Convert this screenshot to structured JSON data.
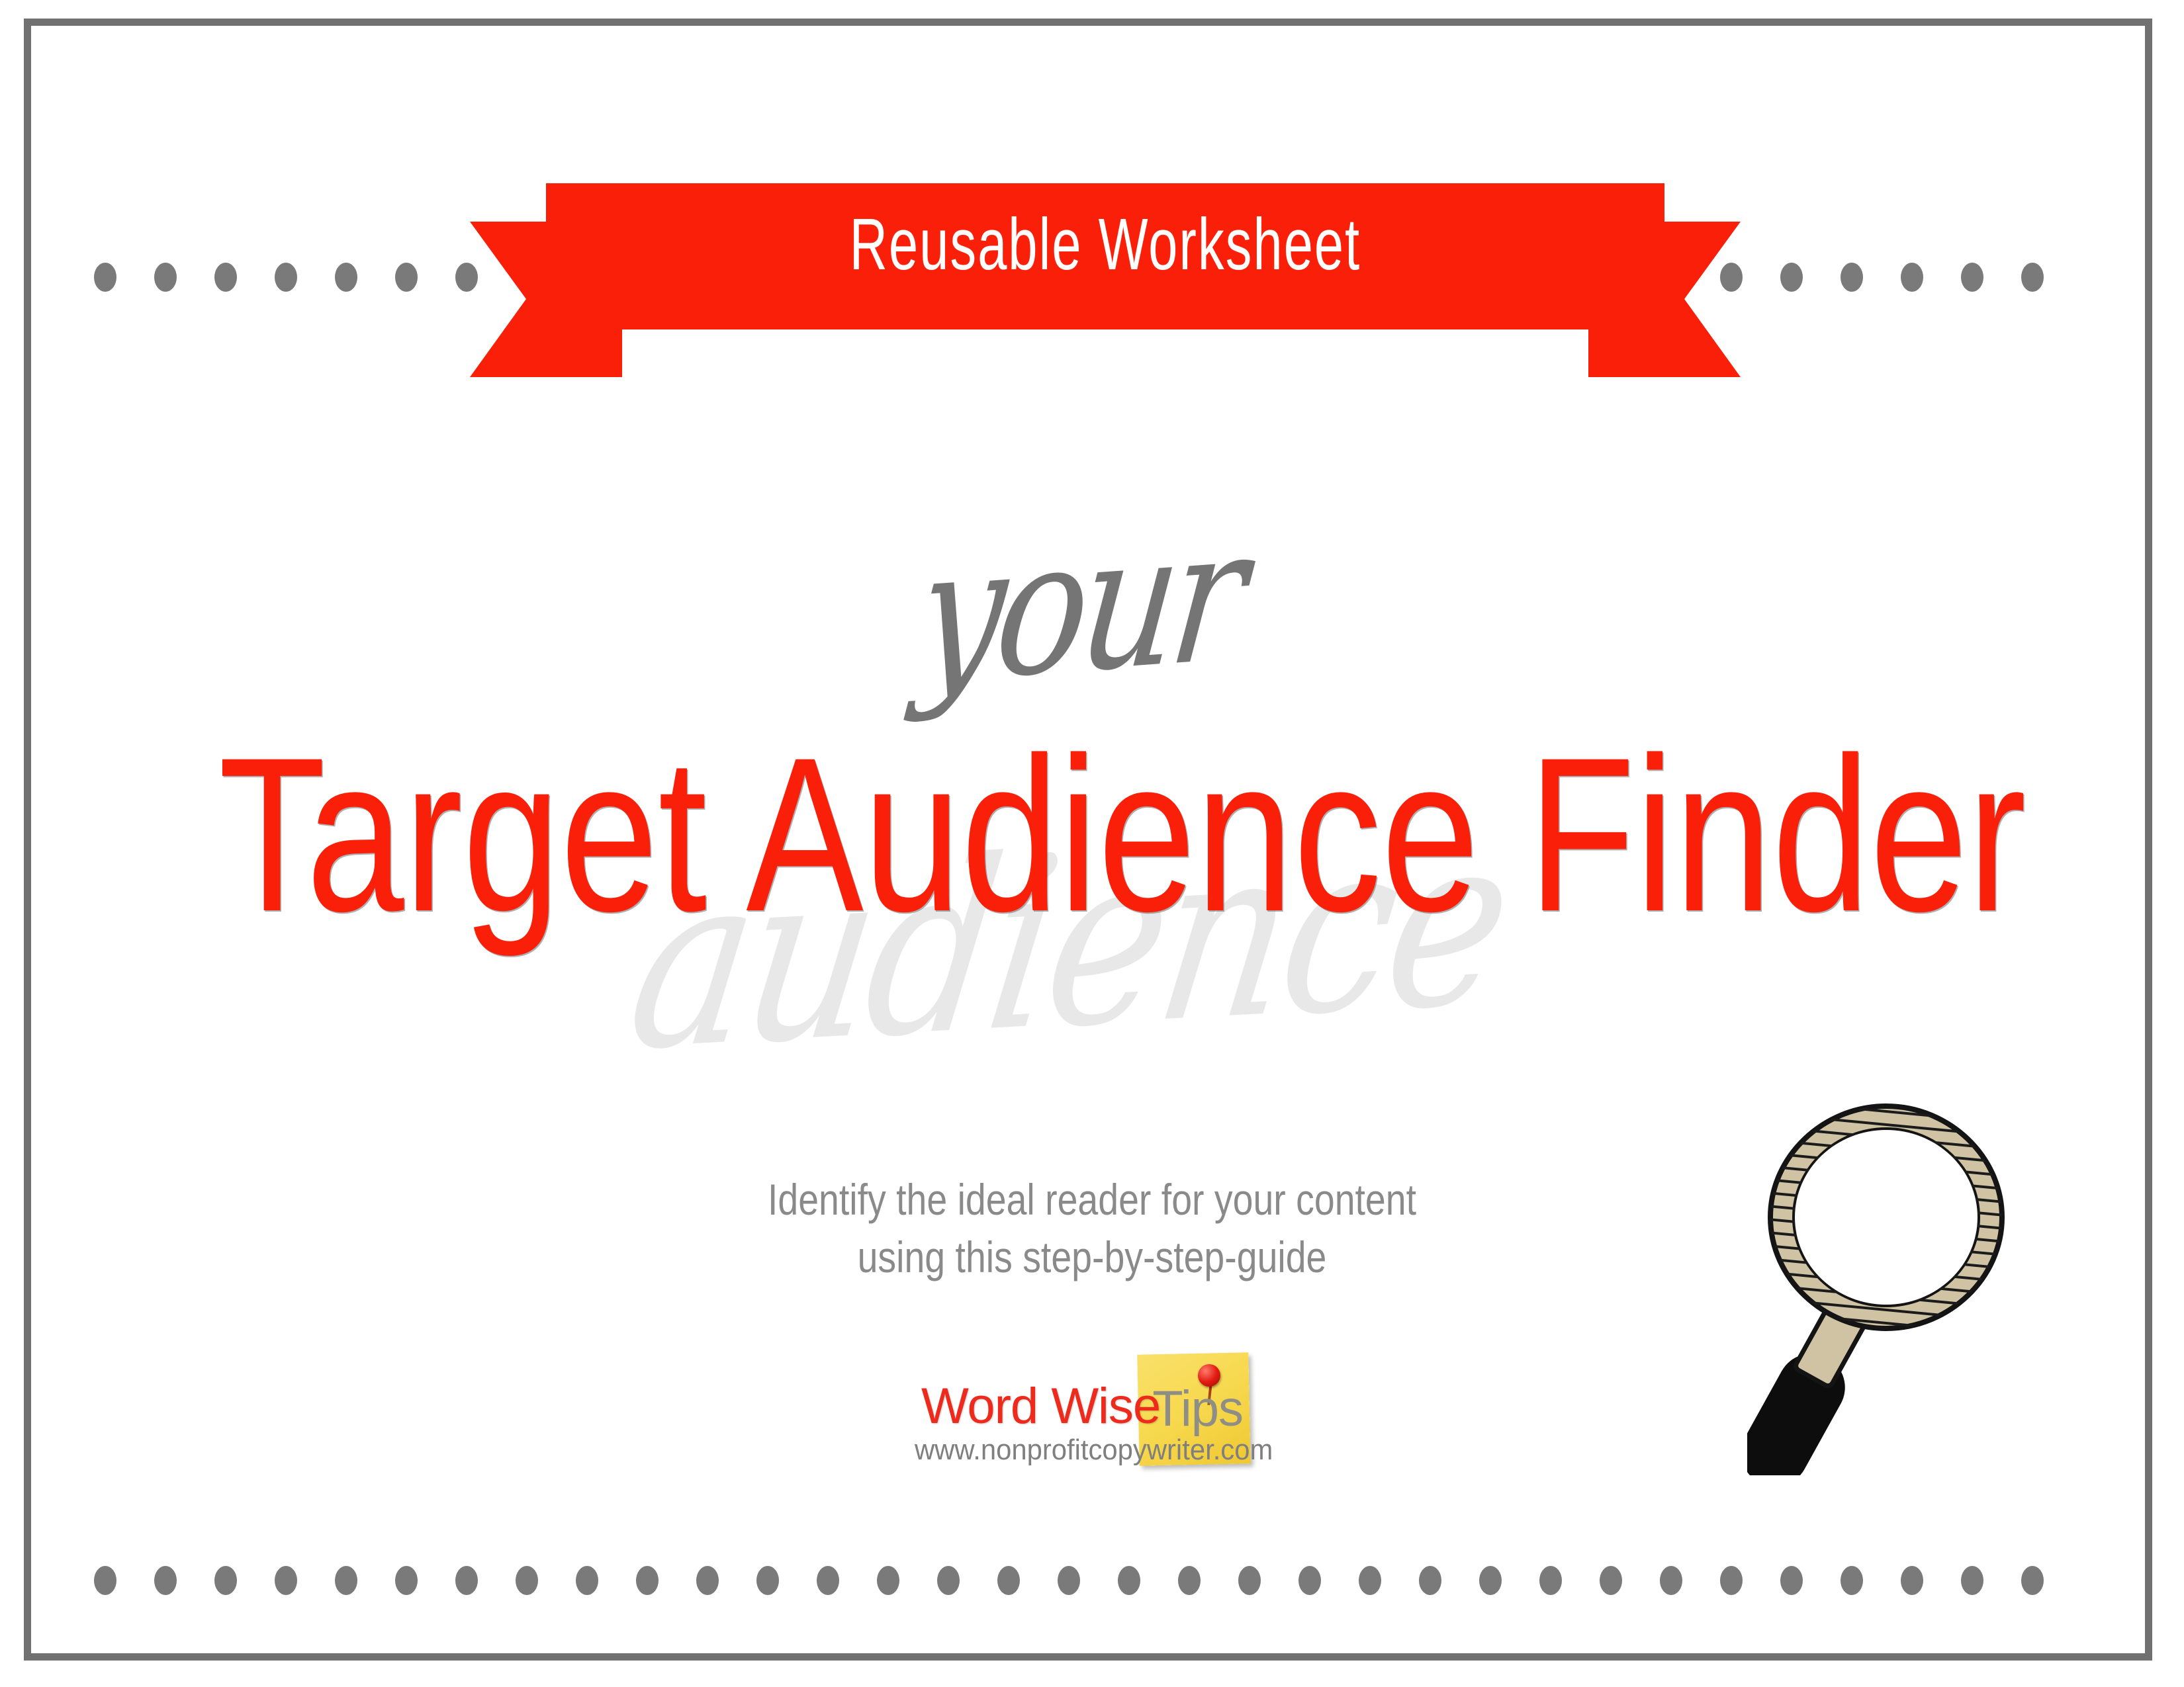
{
  "document": {
    "type": "worksheet-cover-page",
    "page_background": "#ffffff",
    "border_color": "#717171",
    "accent_red": "#f91f08",
    "accent_gray": "#7a7a7a"
  },
  "ribbon": {
    "label": "Reusable Worksheet",
    "fill": "#f91f08",
    "text_color": "#ffffff"
  },
  "decor": {
    "dot_row_top": {
      "name": "dotted-divider-top",
      "dot_color": "#7a7a7a",
      "dot_count": 33
    },
    "dot_row_bottom": {
      "name": "dotted-divider-bottom",
      "dot_color": "#7a7a7a",
      "dot_count": 33
    }
  },
  "headline": {
    "script_word": "your",
    "script_word_color": "#757575",
    "title": "Target Audience Finder",
    "title_color": "#f91f08",
    "ghost_word": "audience",
    "ghost_word_color": "#e8e8e8"
  },
  "subtitle": {
    "line1": "Identify the ideal reader for your content",
    "line2": "using this step-by-step-guide",
    "color": "#8a8a8a"
  },
  "logo": {
    "word_wise": "Word Wise",
    "tips": "Tips",
    "url": "www.nonprofitcopywriter.com",
    "word_wise_color": "#ee2a1c",
    "tips_color": "#8e8d86",
    "note_color": "#f7d94f",
    "pin_color": "#e31b12",
    "sticky_note_icon": "sticky-note-icon",
    "pin_icon": "push-pin-icon"
  },
  "magnifier": {
    "icon": "magnifying-glass-icon",
    "ring_color": "#cfc3a4",
    "handle_color": "#0d0d0d",
    "outline_color": "#141414"
  }
}
